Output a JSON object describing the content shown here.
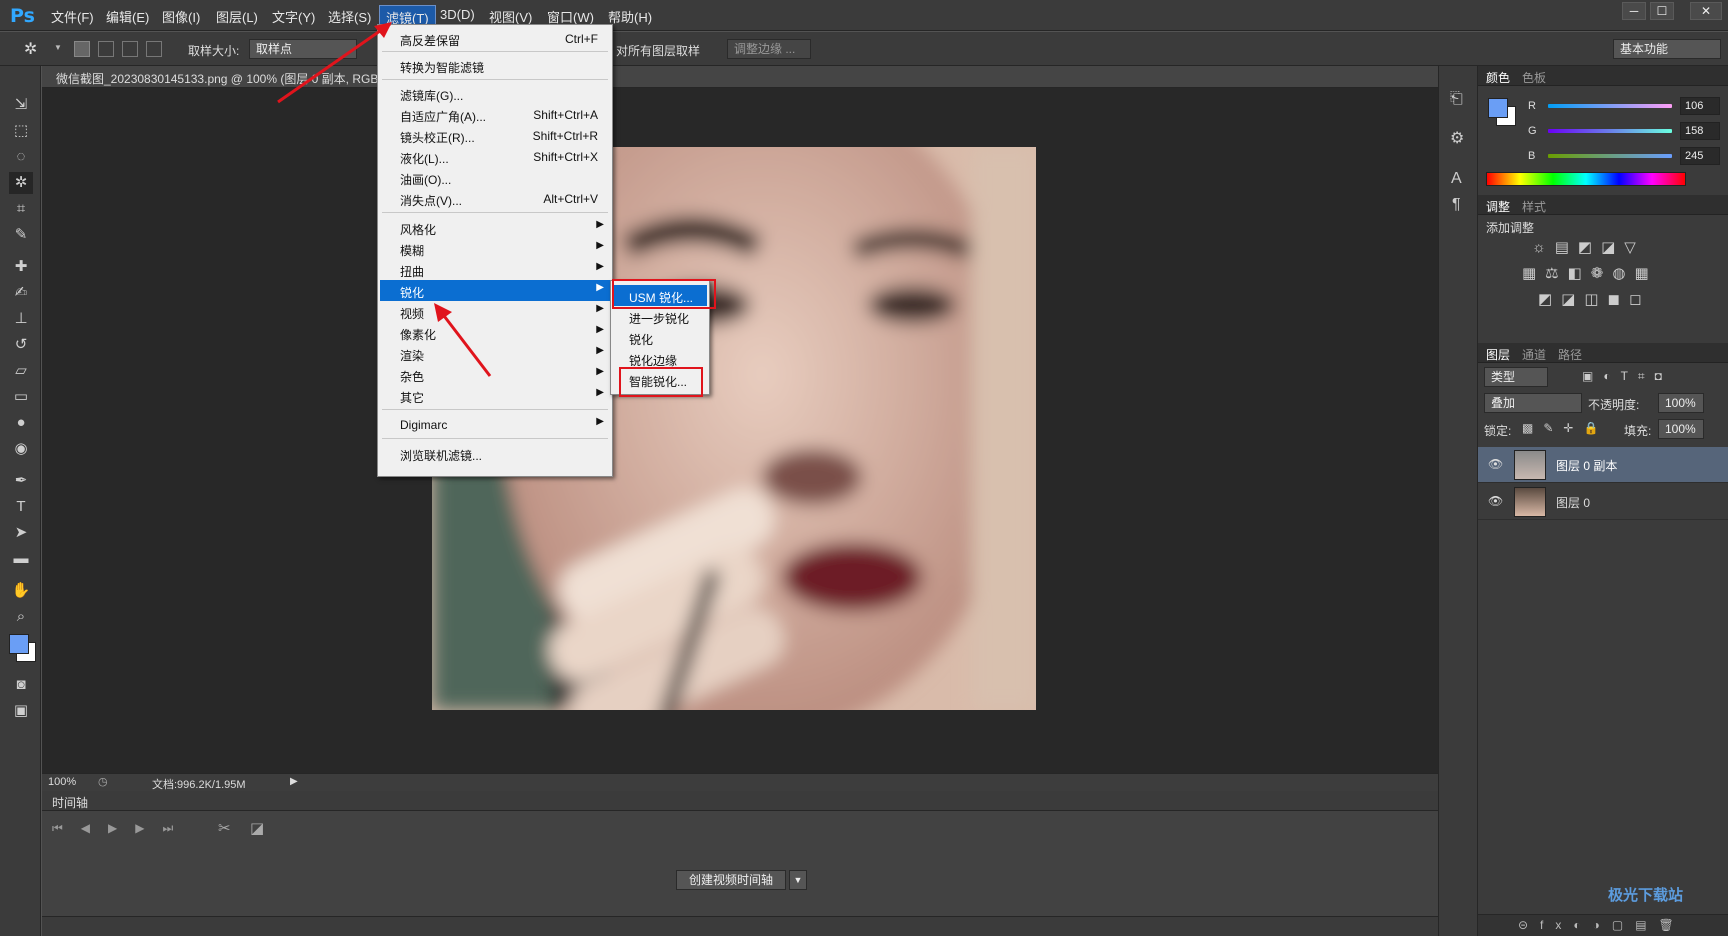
{
  "app": {
    "logo": "Ps"
  },
  "menubar": {
    "items": [
      "文件(F)",
      "编辑(E)",
      "图像(I)",
      "图层(L)",
      "文字(Y)",
      "选择(S)",
      "滤镜(T)",
      "3D(D)",
      "视图(V)",
      "窗口(W)",
      "帮助(H)"
    ],
    "window_buttons": [
      "─",
      "☐",
      "✕"
    ]
  },
  "options": {
    "sample_size_label": "取样大小:",
    "sample_size_value": "取样点",
    "all_layers": "对所有图层取样",
    "refine_edge": "调整边缘 ...",
    "workspace": "基本功能"
  },
  "document": {
    "tab_title": "微信截图_20230830145133.png @ 100% (图层 0 副本, RGB",
    "zoom": "100%",
    "doc_size": "文档:996.2K/1.95M"
  },
  "timeline": {
    "title": "时间轴",
    "create_button": "创建视频时间轴"
  },
  "filter_menu": {
    "items": [
      {
        "label": "高反差保留",
        "shortcut": "Ctrl+F"
      },
      {
        "label": "转换为智能滤镜",
        "shortcut": ""
      },
      {
        "label": "滤镜库(G)...",
        "shortcut": ""
      },
      {
        "label": "自适应广角(A)...",
        "shortcut": "Shift+Ctrl+A"
      },
      {
        "label": "镜头校正(R)...",
        "shortcut": "Shift+Ctrl+R"
      },
      {
        "label": "液化(L)...",
        "shortcut": "Shift+Ctrl+X"
      },
      {
        "label": "油画(O)...",
        "shortcut": ""
      },
      {
        "label": "消失点(V)...",
        "shortcut": "Alt+Ctrl+V"
      },
      {
        "label": "风格化",
        "shortcut": ""
      },
      {
        "label": "模糊",
        "shortcut": ""
      },
      {
        "label": "扭曲",
        "shortcut": ""
      },
      {
        "label": "锐化",
        "shortcut": ""
      },
      {
        "label": "视频",
        "shortcut": ""
      },
      {
        "label": "像素化",
        "shortcut": ""
      },
      {
        "label": "渲染",
        "shortcut": ""
      },
      {
        "label": "杂色",
        "shortcut": ""
      },
      {
        "label": "其它",
        "shortcut": ""
      },
      {
        "label": "Digimarc",
        "shortcut": ""
      },
      {
        "label": "浏览联机滤镜...",
        "shortcut": ""
      }
    ]
  },
  "sharpen_submenu": {
    "items": [
      "USM 锐化...",
      "进一步锐化",
      "锐化",
      "锐化边缘",
      "智能锐化..."
    ]
  },
  "color_panel": {
    "tabs": [
      "颜色",
      "色板"
    ],
    "channels": [
      {
        "name": "R",
        "value": "106"
      },
      {
        "name": "G",
        "value": "158"
      },
      {
        "name": "B",
        "value": "245"
      }
    ],
    "foreground": "#6a9ef5"
  },
  "adjust_panel": {
    "tabs": [
      "调整",
      "样式"
    ],
    "title": "添加调整"
  },
  "layers_panel": {
    "tabs": [
      "图层",
      "通道",
      "路径"
    ],
    "filter_kind": "类型",
    "blend_mode": "叠加",
    "opacity_label": "不透明度:",
    "opacity": "100%",
    "lock_label": "锁定:",
    "fill_label": "填充:",
    "fill": "100%",
    "layers": [
      {
        "name": "图层 0 副本",
        "selected": true
      },
      {
        "name": "图层 0",
        "selected": false
      }
    ]
  },
  "watermark": {
    "text": "极光下载站"
  }
}
